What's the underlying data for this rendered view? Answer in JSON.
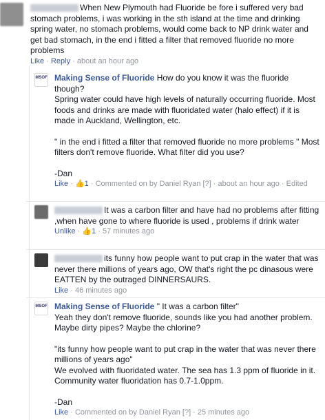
{
  "comments": [
    {
      "text": "When New Plymouth had Fluoride be fore i suffered very bad stomach problems, i was working in the sth island at the time and drinking spring water, no stomach problems, would come back to NP drink water and get bad stomach, in the end i fitted a filter that removed fluoride no more problems",
      "like": "Like",
      "reply": "Reply",
      "time": "about an hour ago"
    }
  ],
  "replies": [
    {
      "author": "Making Sense of Fluoride",
      "avatar_text": "MSOF",
      "lines": [
        "How do you know it was the fluoride though?",
        "Spring water could have high levels of naturally occurring fluoride. Most foods and drinks are made with fluoridated water (halo effect) if it is made in Auckland, Wellington, etc.",
        "",
        "\" in the end i fitted a filter that removed fluoride no more problems \" Most filters don't remove fluoride. What filter did you use?",
        "",
        "-Dan"
      ],
      "like": "Like",
      "like_icon": "👍",
      "likes": "1",
      "commented_on_by": "Commented on by Daniel Ryan",
      "help": "[?]",
      "time": "about an hour ago",
      "edited": "Edited"
    },
    {
      "author": "",
      "text": "It was a carbon filter and have had no problems after fitting ,when have gone to where fluoride is used , problems if drink water",
      "like": "Unlike",
      "like_icon": "👍",
      "likes": "1",
      "time": "57 minutes ago"
    },
    {
      "author": "",
      "text": "its funny how people want to put crap in the water that was never there millions of years ago, OW that's right the pc dinasous were EATTEN by the outraged DINNERSAURS.",
      "like": "Like",
      "time": "46 minutes ago"
    },
    {
      "author": "Making Sense of Fluoride",
      "avatar_text": "MSOF",
      "lines": [
        "\" It was a carbon filter\"",
        "Yeah they don't remove fluoride, sounds like you had another problem. Maybe dirty pipes? Maybe the chlorine?",
        "",
        "\"its funny how people want to put crap in the water that was never there millions of years ago\"",
        "We evolved with fluoridated water. The sea has 1.3 ppm of fluoride in it. Community water fluoridation has 0.7-1.0ppm.",
        "",
        "-Dan"
      ],
      "like": "Like",
      "commented_on_by": "Commented on by Daniel Ryan",
      "help": "[?]",
      "time": "25 minutes ago"
    }
  ]
}
